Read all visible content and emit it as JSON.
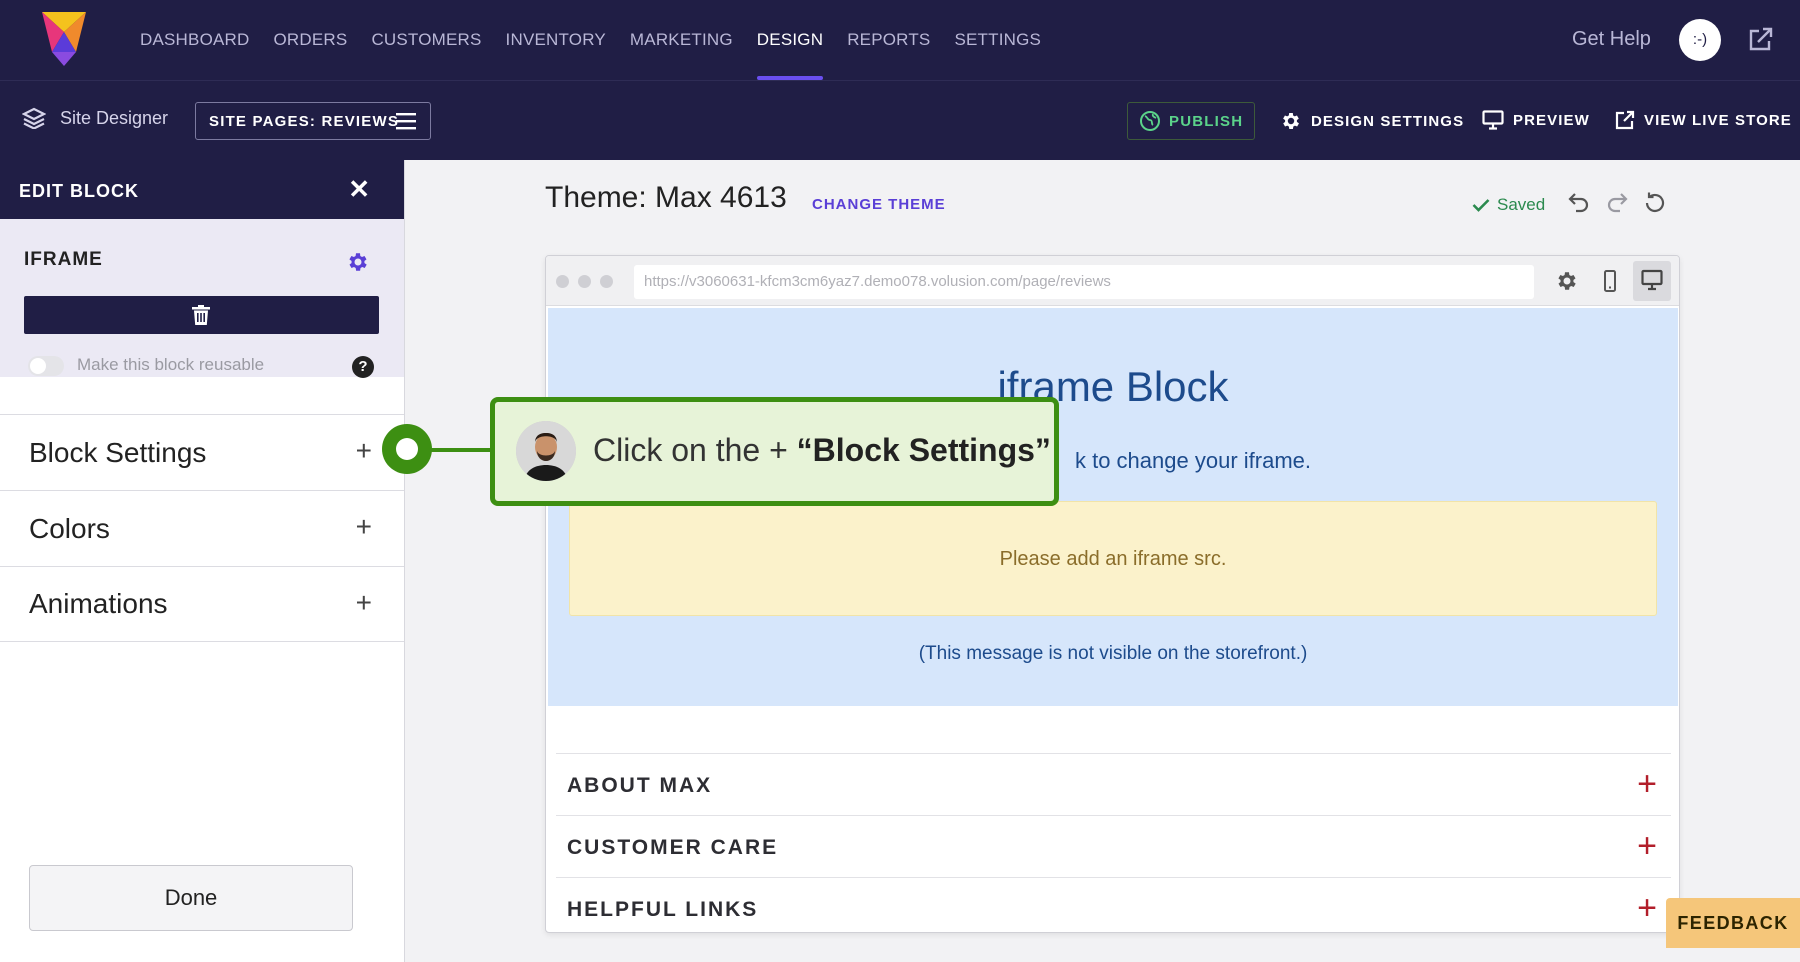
{
  "topnav": {
    "items": [
      "DASHBOARD",
      "ORDERS",
      "CUSTOMERS",
      "INVENTORY",
      "MARKETING",
      "DESIGN",
      "REPORTS",
      "SETTINGS"
    ],
    "active": "DESIGN",
    "get_help": "Get Help",
    "avatar_text": ":-)"
  },
  "subnav": {
    "site_designer": "Site Designer",
    "pages_button": "SITE PAGES: REVIEWS",
    "publish": "PUBLISH",
    "design_settings": "DESIGN SETTINGS",
    "preview": "PREVIEW",
    "view_live_store": "VIEW LIVE STORE"
  },
  "left_panel": {
    "header": "EDIT BLOCK",
    "block_type": "IFRAME",
    "reusable_label": "Make this block reusable",
    "reusable_on": false,
    "sections": [
      "Block Settings",
      "Colors",
      "Animations"
    ],
    "done": "Done"
  },
  "main": {
    "theme_title": "Theme: Max 4613",
    "change_theme": "CHANGE THEME",
    "saved": "Saved",
    "url": "https://v3060631-kfcm3cm6yaz7.demo078.volusion.com/page/reviews",
    "iframe_heading": "iframe Block",
    "iframe_sub_visible": "k to change your iframe.",
    "warning": "Please add an iframe src.",
    "not_visible_note": "(This message is not visible on the storefront.)",
    "footer_sections": [
      "ABOUT MAX",
      "CUSTOMER CARE",
      "HELPFUL LINKS"
    ]
  },
  "callout": {
    "prefix": "Click on the + ",
    "emphasis": "“Block Settings”"
  },
  "feedback": "FEEDBACK",
  "colors": {
    "nav_bg": "#201e45",
    "accent_purple": "#6a4ff0",
    "callout_green": "#3d8f12",
    "iframe_bg": "#d6e6fb",
    "warning_bg": "#fbf2cb",
    "footer_plus": "#b21e2a"
  }
}
